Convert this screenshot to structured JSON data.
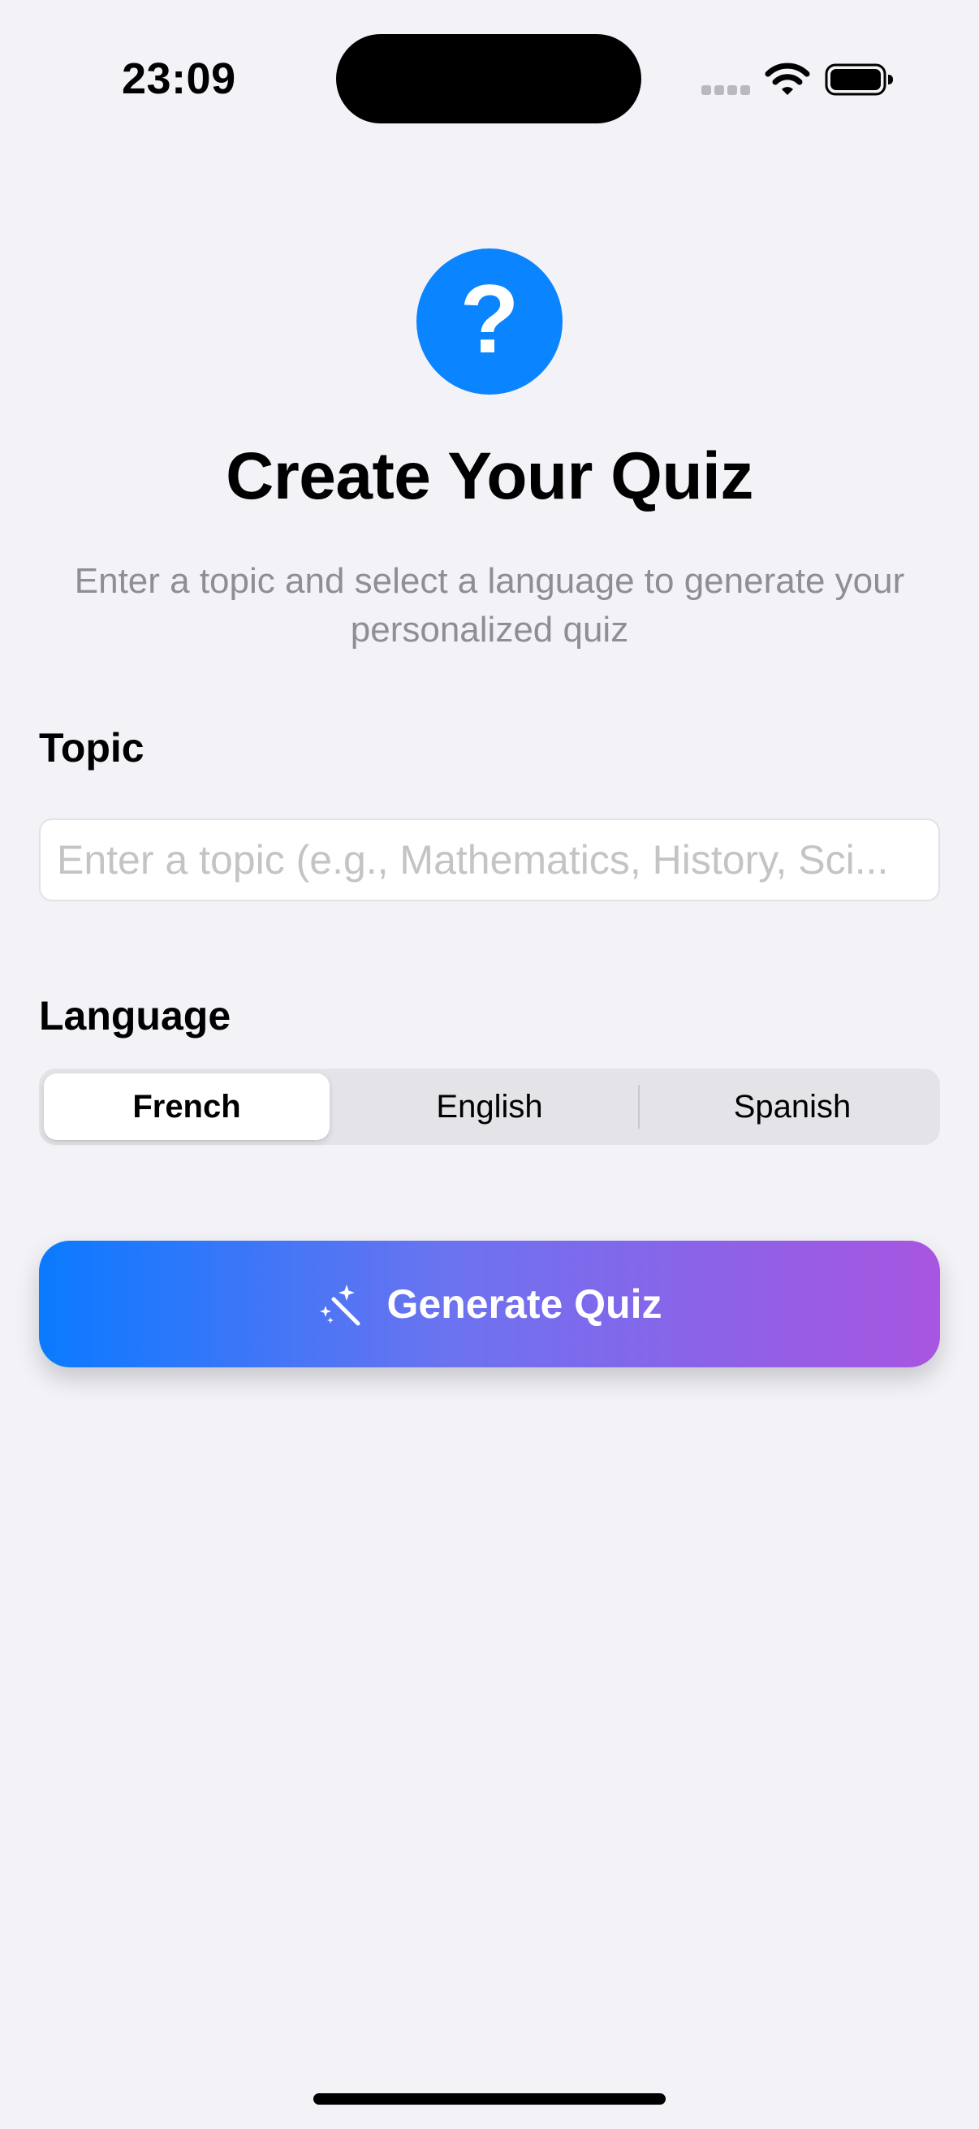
{
  "status_bar": {
    "time": "23:09",
    "icons": [
      "signal-icon",
      "wifi-icon",
      "battery-icon"
    ]
  },
  "header": {
    "logo_glyph": "?",
    "logo_color": "#0A84FF",
    "title": "Create Your Quiz",
    "subtitle": "Enter a topic and select a language to generate your personalized quiz"
  },
  "topic": {
    "label": "Topic",
    "value": "",
    "placeholder": "Enter a topic (e.g., Mathematics, History, Sci..."
  },
  "language": {
    "label": "Language",
    "options": [
      "French",
      "English",
      "Spanish"
    ],
    "selected": "French"
  },
  "generate_button": {
    "label": "Generate Quiz",
    "icon": "magic-wand-icon",
    "gradient": [
      "#0A7AFF",
      "#6B73F0",
      "#A855E0"
    ]
  },
  "colors": {
    "background": "#F2F2F7",
    "accent": "#0A84FF",
    "secondary_text": "#8E8E93"
  }
}
